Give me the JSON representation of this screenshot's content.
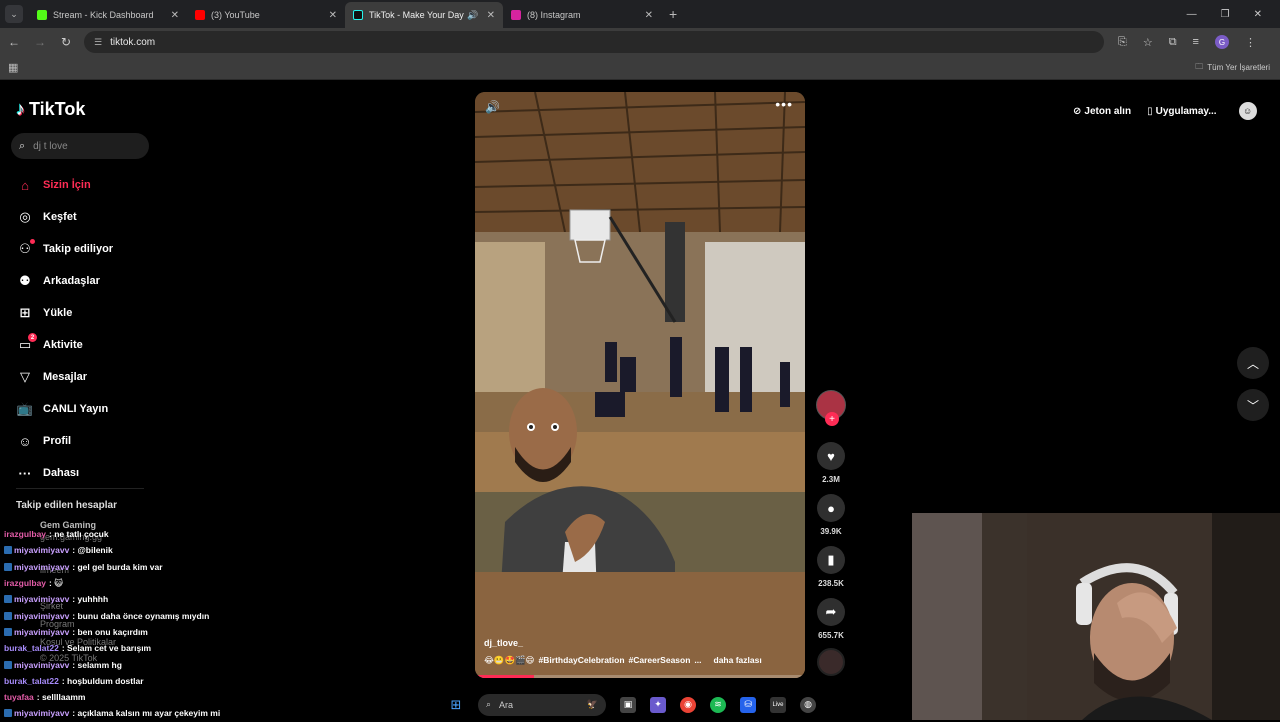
{
  "browser": {
    "tabs": [
      {
        "title": "Stream - Kick Dashboard",
        "color": "#53fc18"
      },
      {
        "title": "(3) YouTube",
        "color": "#ff0000"
      },
      {
        "title": "TikTok - Make Your Day",
        "color": "#111111"
      },
      {
        "title": "(8) Instagram",
        "color": "#d6249f"
      }
    ],
    "url": "tiktok.com",
    "profile_initial": "G",
    "bookmarks_label": "Tüm Yer İşaretleri"
  },
  "tiktok": {
    "logo_text": "TikTok",
    "search_placeholder": "dj t love",
    "menu": [
      {
        "label": "Sizin İçin",
        "icon": "home-icon"
      },
      {
        "label": "Keşfet",
        "icon": "compass-icon"
      },
      {
        "label": "Takip ediliyor",
        "icon": "following-icon"
      },
      {
        "label": "Arkadaşlar",
        "icon": "friends-icon"
      },
      {
        "label": "Yükle",
        "icon": "upload-icon"
      },
      {
        "label": "Aktivite",
        "icon": "activity-icon",
        "badge": "2"
      },
      {
        "label": "Mesajlar",
        "icon": "messages-icon"
      },
      {
        "label": "CANLI Yayın",
        "icon": "live-icon"
      },
      {
        "label": "Profil",
        "icon": "profile-icon"
      },
      {
        "label": "Dahası",
        "icon": "more-icon"
      }
    ],
    "following_title": "Takip edilen hesaplar",
    "faded_text": [
      "Gem Gaming",
      "gem.gaming.gg",
      "ilmeem",
      "Şirket",
      "Program",
      "Koşul ve Politikalar",
      "© 2025 TikTok"
    ],
    "top_right": {
      "coins": "Jeton alın",
      "app": "Uygulamay..."
    },
    "video": {
      "author": "dj_tlove_",
      "emojis": "😂😬🤩🎬😄",
      "hashtags": [
        "#BirthdayCelebration",
        "#CareerSeason",
        "..."
      ],
      "more_label": "daha fazlası",
      "progress": 0.18
    },
    "actions": {
      "likes": "2.3M",
      "comments": "39.9K",
      "saves": "238.5K",
      "shares": "655.7K"
    }
  },
  "chat": [
    {
      "user": "irazgulbay",
      "msg": ": ne tatlı çocuk",
      "color": "#e35ca8",
      "badge": false
    },
    {
      "user": "miyavimiyavv",
      "msg": ": @bilenik",
      "color": "#c9a0ff",
      "badge": true
    },
    {
      "user": "miyavimiyavv",
      "msg": ": gel gel burda kim var",
      "color": "#c9a0ff",
      "badge": true
    },
    {
      "user": "irazgulbay",
      "msg": ": 😺",
      "color": "#e35ca8",
      "badge": false
    },
    {
      "user": "miyavimiyavv",
      "msg": ": yuhhhh",
      "color": "#c9a0ff",
      "badge": true
    },
    {
      "user": "miyavimiyavv",
      "msg": ": bunu daha önce oynamış mıydın",
      "color": "#c9a0ff",
      "badge": true
    },
    {
      "user": "miyavimiyavv",
      "msg": ": ben onu kaçırdım",
      "color": "#c9a0ff",
      "badge": true
    },
    {
      "user": "burak_talat22",
      "msg": ": Selam cet ve barışım",
      "color": "#a78bfa",
      "badge": false
    },
    {
      "user": "miyavimiyavv",
      "msg": ": selamm hg",
      "color": "#c9a0ff",
      "badge": true
    },
    {
      "user": "burak_talat22",
      "msg": ": hoşbuldum dostlar",
      "color": "#a78bfa",
      "badge": false
    },
    {
      "user": "tuyafaa",
      "msg": ": sellllaamm",
      "color": "#e35ca8",
      "badge": false
    },
    {
      "user": "miyavimiyavv",
      "msg": ": açıklama kalsın mı ayar çekeyim mi",
      "color": "#c9a0ff",
      "badge": true
    }
  ],
  "taskbar": {
    "search_label": "Ara"
  }
}
